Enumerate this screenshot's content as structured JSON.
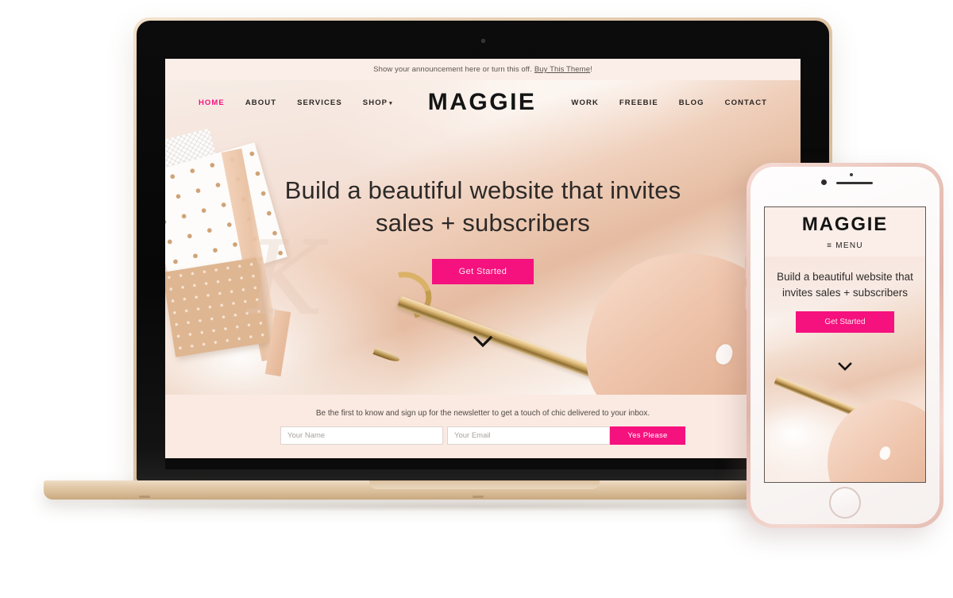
{
  "site": {
    "announcement": {
      "text": "Show your announcement here or turn this off.",
      "link_label": "Buy This Theme",
      "suffix": "!"
    },
    "brand": "MAGGIE",
    "nav_left": [
      {
        "label": "HOME",
        "active": true
      },
      {
        "label": "ABOUT",
        "active": false
      },
      {
        "label": "SERVICES",
        "active": false
      },
      {
        "label": "SHOP",
        "active": false,
        "caret": "▾"
      }
    ],
    "nav_right": [
      {
        "label": "WORK"
      },
      {
        "label": "FREEBIE"
      },
      {
        "label": "BLOG"
      },
      {
        "label": "CONTACT"
      }
    ],
    "hero": {
      "line1": "Build a beautiful website that invites",
      "line2": "sales + subscribers",
      "cta_label": "Get Started",
      "scroll_icon": "chevron-down-icon",
      "watermark": "K"
    },
    "newsletter": {
      "text": "Be the first to know and sign up for the newsletter to get a touch of chic delivered to your inbox.",
      "name_placeholder": "Your Name",
      "name_value": "",
      "email_placeholder": "Your Email",
      "email_value": "",
      "submit_label": "Yes Please"
    }
  },
  "phone": {
    "brand": "MAGGIE",
    "menu_label": "MENU",
    "menu_icon": "hamburger-icon",
    "hero": {
      "line1": "Build a beautiful website that",
      "line2": "invites sales + subscribers",
      "cta_label": "Get Started",
      "scroll_icon": "chevron-down-icon"
    }
  },
  "colors": {
    "accent_pink": "#f5117e",
    "announce_bg": "#fbeee8",
    "newsletter_bg": "#fbeae2",
    "text_dark": "#2b2523",
    "laptop_gold": "#d9bb98",
    "phone_rose_gold": "#e0b3a8"
  }
}
